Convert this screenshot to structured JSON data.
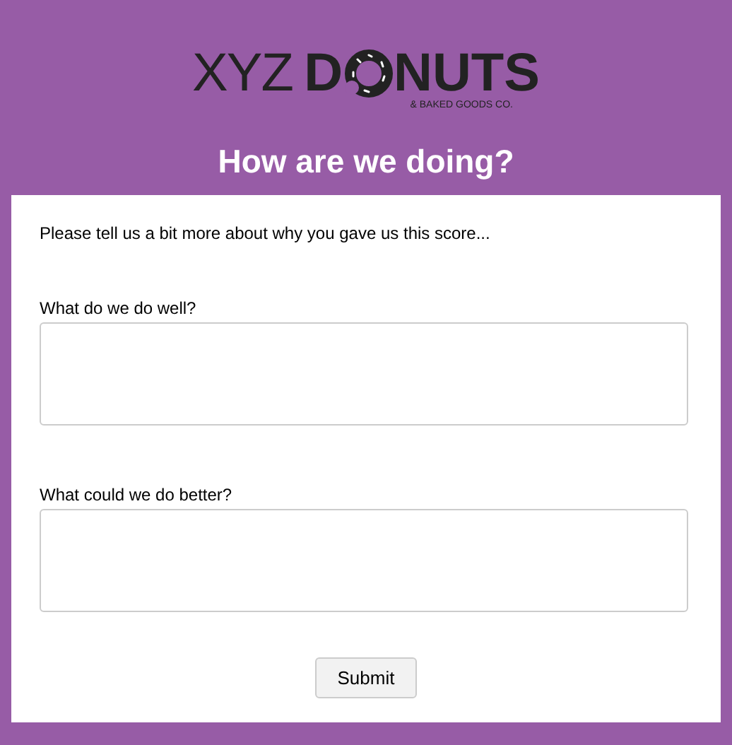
{
  "logo": {
    "prefix": "XYZ",
    "brand_start": "D",
    "brand_end": "NUTS",
    "tagline": "& BAKED GOODS CO."
  },
  "title": "How are we doing?",
  "intro": "Please tell us a bit more about why you gave us this score...",
  "questions": [
    {
      "label": "What do we do well?"
    },
    {
      "label": "What could we do better?"
    }
  ],
  "submit": "Submit"
}
